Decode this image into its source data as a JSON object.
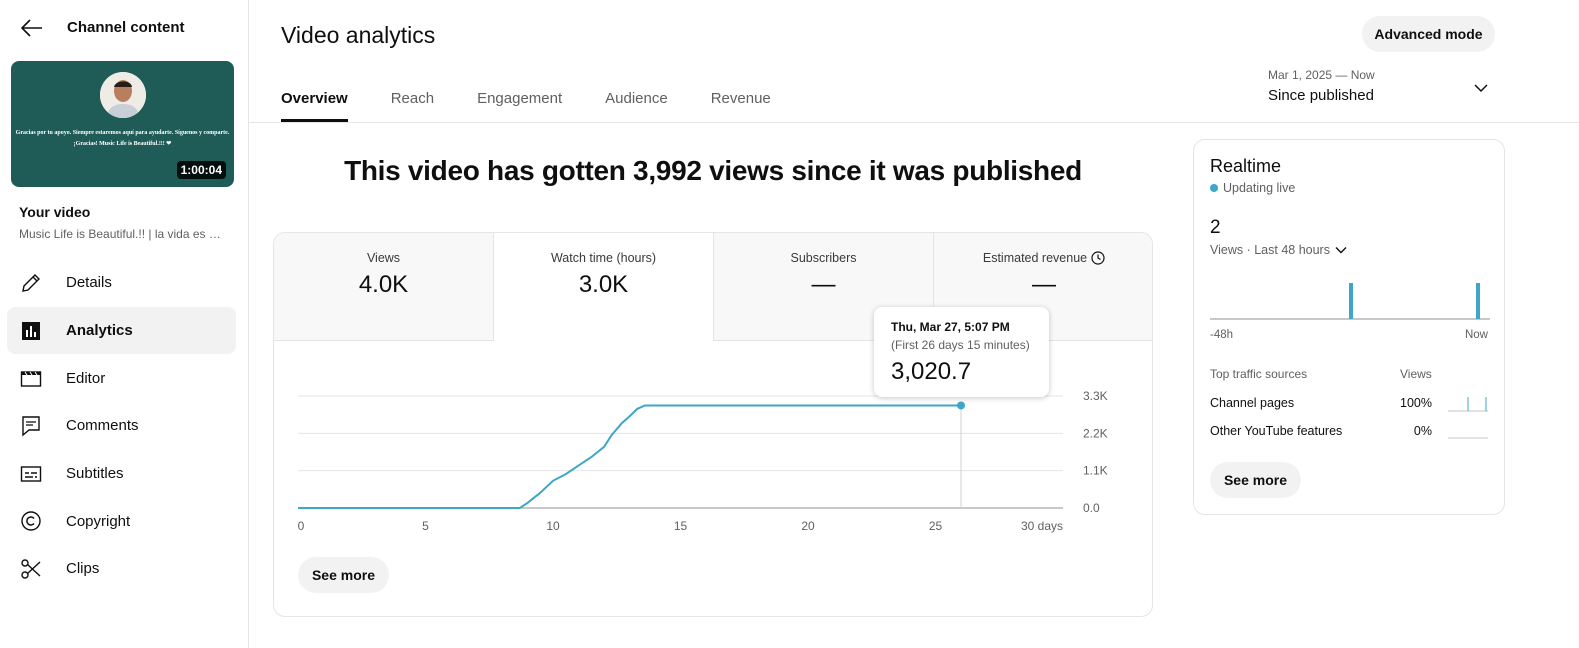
{
  "sidebar": {
    "header_title": "Channel content",
    "thumbnail": {
      "text": "Gracias por tu apoyo. Siempre estaremos aquí para ayudarte. Síguenos y comparte. ¡Gracias! Music Life is Beautiful.!!! ❤",
      "duration": "1:00:04"
    },
    "your_video_label": "Your video",
    "video_title": "Music Life is Beautiful.!! | la vida es …",
    "items": [
      {
        "label": "Details",
        "icon": "pencil-icon"
      },
      {
        "label": "Analytics",
        "icon": "analytics-icon"
      },
      {
        "label": "Editor",
        "icon": "clapperboard-icon"
      },
      {
        "label": "Comments",
        "icon": "comment-icon"
      },
      {
        "label": "Subtitles",
        "icon": "subtitles-icon"
      },
      {
        "label": "Copyright",
        "icon": "copyright-icon"
      },
      {
        "label": "Clips",
        "icon": "scissors-icon"
      }
    ],
    "active_item": "Analytics"
  },
  "header": {
    "title": "Video analytics",
    "advanced_mode_label": "Advanced mode",
    "tabs": [
      "Overview",
      "Reach",
      "Engagement",
      "Audience",
      "Revenue"
    ],
    "active_tab": "Overview",
    "date_range": "Mar 1, 2025 — Now",
    "date_value": "Since published"
  },
  "main": {
    "headline": "This video has gotten 3,992 views since it was published",
    "metrics": [
      {
        "label": "Views",
        "value": "4.0K"
      },
      {
        "label": "Watch time (hours)",
        "value": "3.0K"
      },
      {
        "label": "Subscribers",
        "value": "—"
      },
      {
        "label": "Estimated revenue",
        "value": "—"
      }
    ],
    "active_metric": "Watch time (hours)",
    "tooltip": {
      "date": "Thu, Mar 27, 5:07 PM",
      "sub": "(First 26 days 15 minutes)",
      "value": "3,020.7"
    },
    "see_more_label": "See more"
  },
  "chart_data": {
    "type": "line",
    "x_label_suffix": "days",
    "xticks": [
      "0",
      "5",
      "10",
      "15",
      "20",
      "25",
      "30 days"
    ],
    "yticks": [
      "0.0",
      "1.1K",
      "2.2K",
      "3.3K"
    ],
    "ylim": [
      0,
      3300
    ],
    "xlim": [
      0,
      30
    ],
    "grid": true,
    "series": [
      {
        "color": "#3ea6c8",
        "points": [
          [
            0,
            0
          ],
          [
            8.7,
            0
          ],
          [
            9.0,
            150
          ],
          [
            9.5,
            450
          ],
          [
            10.0,
            800
          ],
          [
            10.5,
            1000
          ],
          [
            11.0,
            1250
          ],
          [
            11.5,
            1500
          ],
          [
            12.0,
            1800
          ],
          [
            12.3,
            2150
          ],
          [
            12.7,
            2500
          ],
          [
            13.0,
            2700
          ],
          [
            13.3,
            2920
          ],
          [
            13.6,
            3020
          ],
          [
            26.0,
            3020
          ]
        ]
      }
    ],
    "highlight_point": [
      26.0,
      3020.7
    ]
  },
  "realtime": {
    "title": "Realtime",
    "status": "Updating live",
    "count": "2",
    "metric_label": "Views · Last 48 hours",
    "axis_start": "-48h",
    "axis_end": "Now",
    "traffic_header": "Top traffic sources",
    "views_header": "Views",
    "traffic_sources": [
      {
        "name": "Channel pages",
        "pct": "100%"
      },
      {
        "name": "Other YouTube features",
        "pct": "0%"
      }
    ],
    "see_more_label": "See more",
    "accent_color": "#3ea6c8"
  }
}
